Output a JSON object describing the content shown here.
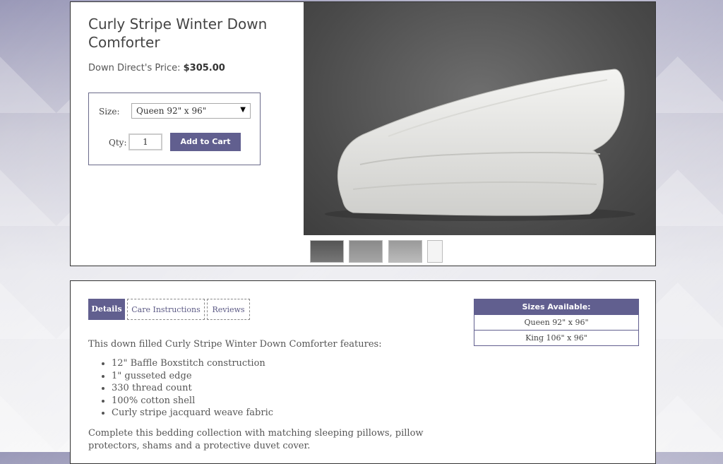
{
  "product": {
    "title": "Curly Stripe Winter Down Comforter",
    "price_label": "Down Direct's Price:",
    "price_value": "$305.00"
  },
  "purchase_form": {
    "size_label": "Size:",
    "size_selected": "Queen 92\" x 96\"",
    "qty_label": "Qty:",
    "qty_value": "1",
    "add_to_cart_label": "Add to Cart"
  },
  "thumbnails": [
    {
      "name": "thumbnail-1"
    },
    {
      "name": "thumbnail-2"
    },
    {
      "name": "thumbnail-3"
    },
    {
      "name": "thumbnail-4"
    }
  ],
  "tabs": [
    {
      "label": "Details",
      "active": true
    },
    {
      "label": "Care Instructions",
      "active": false
    },
    {
      "label": "Reviews",
      "active": false
    }
  ],
  "details": {
    "intro": "This down filled Curly Stripe Winter Down Comforter features:",
    "features": [
      "12\" Baffle Boxstitch construction",
      "1\" gusseted edge",
      "330 thread count",
      "100% cotton shell",
      "Curly stripe jacquard weave fabric"
    ],
    "outro": "Complete this bedding collection with matching sleeping pillows, pillow protectors, shams and a protective duvet cover."
  },
  "sizes_available": {
    "header": "Sizes Available:",
    "rows": [
      "Queen 92\" x 96\"",
      "King 106\" x 96\""
    ]
  },
  "colors": {
    "accent": "#615f8f",
    "hero_bg": "#4a4a4a"
  }
}
